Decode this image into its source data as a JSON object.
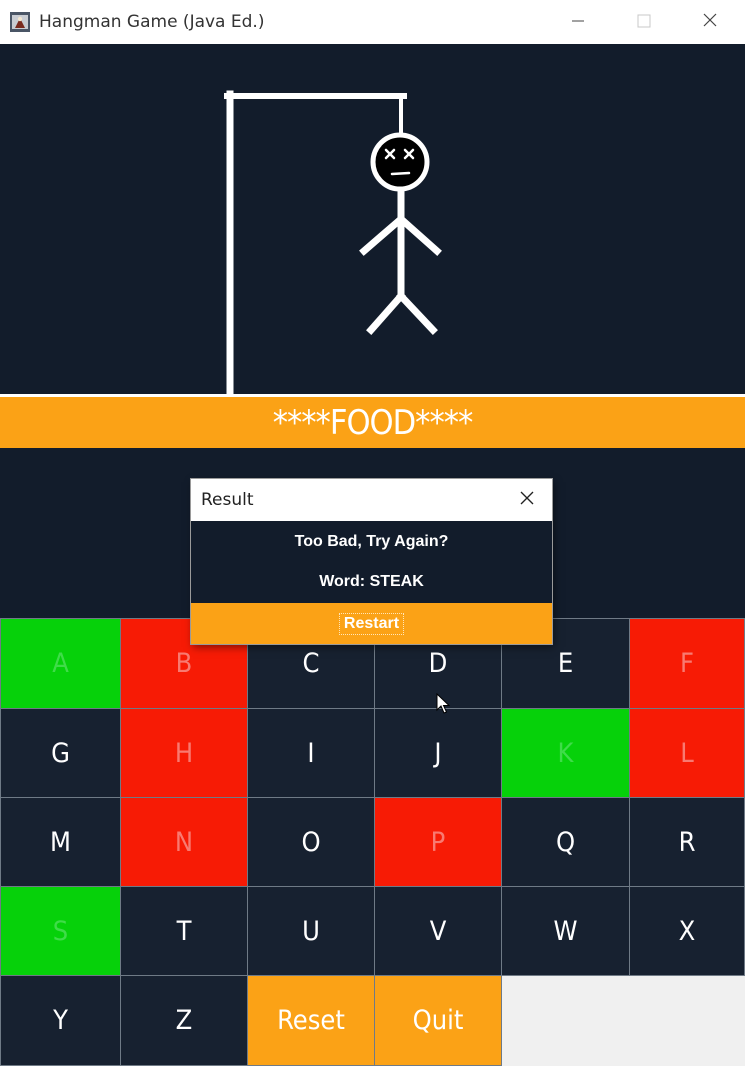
{
  "window": {
    "title": "Hangman Game (Java Ed.)",
    "controls": [
      "minimize",
      "maximize",
      "close"
    ]
  },
  "game": {
    "masked_word": "****FOOD****"
  },
  "dialog": {
    "title": "Result",
    "message": "Too Bad, Try Again?",
    "word_line": "Word: STEAK",
    "restart_label": "Restart"
  },
  "keyboard": {
    "keys": [
      {
        "label": "A",
        "state": "correct"
      },
      {
        "label": "B",
        "state": "wrong"
      },
      {
        "label": "C",
        "state": "unused"
      },
      {
        "label": "D",
        "state": "unused"
      },
      {
        "label": "E",
        "state": "unused"
      },
      {
        "label": "F",
        "state": "wrong"
      },
      {
        "label": "G",
        "state": "unused"
      },
      {
        "label": "H",
        "state": "wrong"
      },
      {
        "label": "I",
        "state": "unused"
      },
      {
        "label": "J",
        "state": "unused"
      },
      {
        "label": "K",
        "state": "correct"
      },
      {
        "label": "L",
        "state": "wrong"
      },
      {
        "label": "M",
        "state": "unused"
      },
      {
        "label": "N",
        "state": "wrong"
      },
      {
        "label": "O",
        "state": "unused"
      },
      {
        "label": "P",
        "state": "wrong"
      },
      {
        "label": "Q",
        "state": "unused"
      },
      {
        "label": "R",
        "state": "unused"
      },
      {
        "label": "S",
        "state": "correct"
      },
      {
        "label": "T",
        "state": "unused"
      },
      {
        "label": "U",
        "state": "unused"
      },
      {
        "label": "V",
        "state": "unused"
      },
      {
        "label": "W",
        "state": "unused"
      },
      {
        "label": "X",
        "state": "unused"
      },
      {
        "label": "Y",
        "state": "unused"
      },
      {
        "label": "Z",
        "state": "unused"
      }
    ],
    "reset_label": "Reset",
    "quit_label": "Quit"
  },
  "colors": {
    "background": "#121c2b",
    "accent_orange": "#fba216",
    "correct_green": "#06d10a",
    "wrong_red": "#f71b05",
    "key_dark": "#172130"
  }
}
